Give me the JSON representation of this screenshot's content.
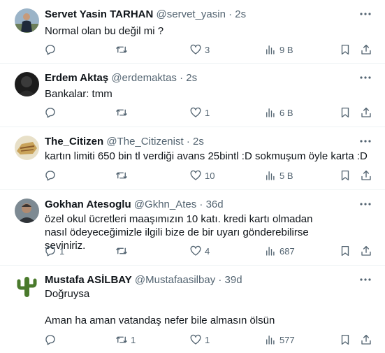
{
  "tweets": [
    {
      "name": "Servet Yasin TARHAN",
      "handle": "@servet_yasin",
      "sep": "·",
      "time": "2s",
      "text": "Normal olan bu değil mi ?",
      "replies": "",
      "retweets": "",
      "likes": "3",
      "views": "9 B",
      "avatar": "avatar-servet"
    },
    {
      "name": "Erdem Aktaş",
      "handle": "@erdemaktas",
      "sep": "·",
      "time": "2s",
      "text": "Bankalar: tmm",
      "replies": "",
      "retweets": "",
      "likes": "1",
      "views": "6 B",
      "avatar": "avatar-erdem"
    },
    {
      "name": "The_Citizen",
      "handle": "@The_Citizenist",
      "sep": "·",
      "time": "2s",
      "text": "kartın limiti 650 bin tl verdiği avans 25bintl :D sokmuşum öyle karta :D",
      "replies": "",
      "retweets": "",
      "likes": "10",
      "views": "5 B",
      "avatar": "avatar-citizen"
    },
    {
      "name": "Gokhan Atesoglu",
      "handle": "@Gkhn_Ates",
      "sep": "·",
      "time": "36d",
      "text": "özel okul ücretleri maaşımızın 10 katı. kredi kartı olmadan nasıl ödeyeceğimizle ilgili bize de bir uyarı gönderebilirse seviniriz.",
      "replies": "1",
      "retweets": "",
      "likes": "4",
      "views": "687",
      "avatar": "avatar-gokhan"
    },
    {
      "name": "Mustafa ASİLBAY",
      "handle": "@Mustafaasilbay",
      "sep": "·",
      "time": "39d",
      "text": "Doğruysa\n\nAman ha aman vatandaş nefer bile almasın ölsün",
      "replies": "",
      "retweets": "1",
      "likes": "1",
      "views": "577",
      "avatar": "avatar-cactus"
    }
  ],
  "colors": {
    "text": "#0f1419",
    "muted": "#536471",
    "border": "#eff3f4"
  }
}
